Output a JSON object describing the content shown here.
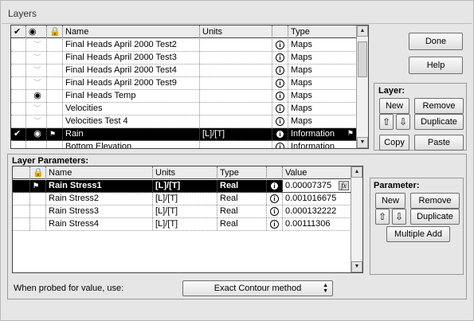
{
  "window": {
    "title": "Layers"
  },
  "layers": {
    "columns": {
      "visible": "✔",
      "eye": "👁",
      "lock": "🔒",
      "name": "Name",
      "units": "Units",
      "type": "Type"
    },
    "rows": [
      {
        "visible": "",
        "eye": "closed",
        "flag": "",
        "name": "Final Heads April 2000 Test2",
        "units": "",
        "type": "Maps",
        "selected": false
      },
      {
        "visible": "",
        "eye": "closed",
        "flag": "",
        "name": "Final Heads April 2000 Test3",
        "units": "",
        "type": "Maps",
        "selected": false
      },
      {
        "visible": "",
        "eye": "closed",
        "flag": "",
        "name": "Final Heads April 2000 Test4",
        "units": "",
        "type": "Maps",
        "selected": false
      },
      {
        "visible": "",
        "eye": "closed",
        "flag": "",
        "name": "Final Heads April 2000 Test9",
        "units": "",
        "type": "Maps",
        "selected": false
      },
      {
        "visible": "",
        "eye": "open",
        "flag": "",
        "name": "Final Heads Temp",
        "units": "",
        "type": "Maps",
        "selected": false
      },
      {
        "visible": "",
        "eye": "closed",
        "flag": "",
        "name": "Velocities",
        "units": "",
        "type": "Maps",
        "selected": false
      },
      {
        "visible": "",
        "eye": "closed",
        "flag": "",
        "name": "Velocities Test 4",
        "units": "",
        "type": "Maps",
        "selected": false
      },
      {
        "visible": "✔",
        "eye": "open",
        "flag": "⚑",
        "name": "Rain",
        "units": "[L]/[T]",
        "type": "Information",
        "selected": true
      },
      {
        "visible": "",
        "eye": "",
        "flag": "",
        "name": "Bottom Elevation",
        "units": "",
        "type": "Information",
        "selected": false
      }
    ],
    "info_glyph": "i"
  },
  "buttons": {
    "done": "Done",
    "help": "Help",
    "layer_group": "Layer:",
    "layer_new": "New",
    "layer_remove": "Remove",
    "layer_up": "⇧",
    "layer_down": "⇩",
    "layer_duplicate": "Duplicate",
    "layer_copy": "Copy",
    "layer_paste": "Paste"
  },
  "parameters": {
    "section_label": "Layer Parameters:",
    "columns": {
      "lock": "🔒",
      "name": "Name",
      "units": "Units",
      "type": "Type",
      "value": "Value"
    },
    "rows": [
      {
        "name": "Rain Stress1",
        "units": "[L]/[T]",
        "type": "Real",
        "value": "0.00007375",
        "selected": true
      },
      {
        "name": "Rain Stress2",
        "units": "[L]/[T]",
        "type": "Real",
        "value": "0.001016675",
        "selected": false
      },
      {
        "name": "Rain Stress3",
        "units": "[L]/[T]",
        "type": "Real",
        "value": "0.000132222",
        "selected": false
      },
      {
        "name": "Rain Stress4",
        "units": "[L]/[T]",
        "type": "Real",
        "value": "0.00111306",
        "selected": false
      }
    ],
    "group_label": "Parameter:",
    "new": "New",
    "remove": "Remove",
    "up": "⇧",
    "down": "⇩",
    "duplicate": "Duplicate",
    "multiple_add": "Multiple Add",
    "fx": "fx"
  },
  "probe": {
    "label": "When probed for value, use:",
    "selected": "Exact Contour method"
  }
}
